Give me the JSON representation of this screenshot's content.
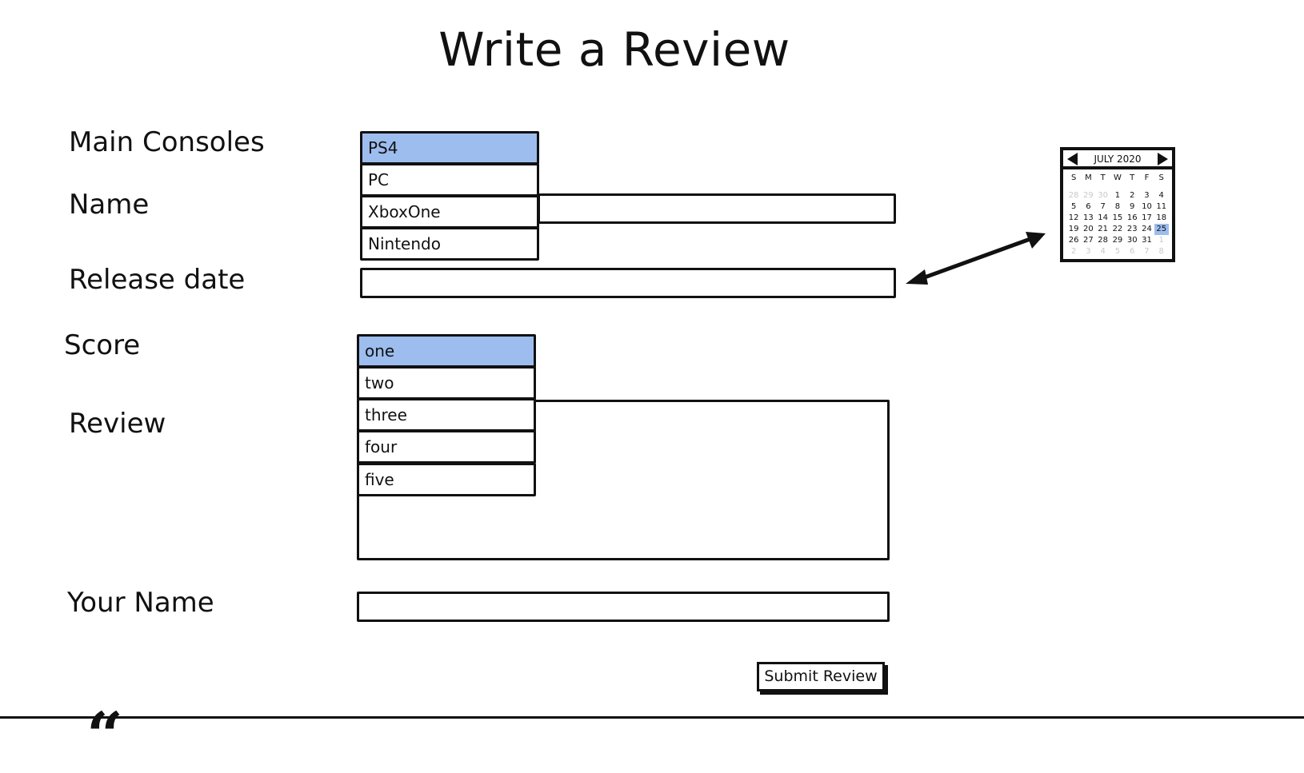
{
  "page": {
    "title": "Write a Review"
  },
  "labels": {
    "main_consoles": "Main Consoles",
    "name": "Name",
    "release_date": "Release date",
    "score": "Score",
    "review": "Review",
    "your_name": "Your Name"
  },
  "consoles": {
    "options": [
      "PS4",
      "PC",
      "XboxOne",
      "Nintendo"
    ],
    "selected": "PS4"
  },
  "scores": {
    "options": [
      "one",
      "two",
      "three",
      "four",
      "five"
    ],
    "selected": "one"
  },
  "fields": {
    "name_value": "",
    "release_date_value": "",
    "review_value": "",
    "your_name_value": ""
  },
  "calendar": {
    "month_label": "JULY 2020",
    "weekdays": [
      "S",
      "M",
      "T",
      "W",
      "T",
      "F",
      "S"
    ],
    "weeks": [
      [
        "28",
        "29",
        "30",
        "1",
        "2",
        "3",
        "4"
      ],
      [
        "5",
        "6",
        "7",
        "8",
        "9",
        "10",
        "11"
      ],
      [
        "12",
        "13",
        "14",
        "15",
        "16",
        "17",
        "18"
      ],
      [
        "19",
        "20",
        "21",
        "22",
        "23",
        "24",
        "25"
      ],
      [
        "26",
        "27",
        "28",
        "29",
        "30",
        "31",
        "1"
      ],
      [
        "2",
        "3",
        "4",
        "5",
        "6",
        "7",
        "8"
      ]
    ],
    "selected_day": "25"
  },
  "buttons": {
    "submit": "Submit Review"
  },
  "colors": {
    "selection": "#9dbdee",
    "ink": "#111111"
  },
  "icons": {
    "prev": "triangle-left-icon",
    "next": "triangle-right-icon",
    "arrow": "double-arrow-icon",
    "quote": "quote-mark-icon"
  }
}
